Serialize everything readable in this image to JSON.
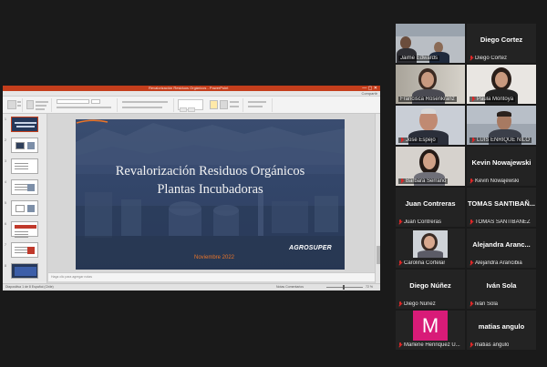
{
  "window": {
    "title": "Revalorización Residuos Orgánicos - PowerPoint",
    "menu": [
      "Archivo",
      "Inicio",
      "Insertar",
      "Diseño",
      "Transiciones",
      "Animaciones",
      "Presentación con diapositivas",
      "Revisar",
      "Vista",
      "Ayuda"
    ],
    "active_menu": "Inicio",
    "right_menu": "Compartir",
    "notes_placeholder": "Haga clic para agregar notas",
    "status_left": "Diapositiva 1 de 8  Español (Chile)",
    "status_mid": "Notas   Comentarios",
    "zoom": "72 %"
  },
  "slide": {
    "title_line1": "Revalorización Residuos Orgánicos",
    "title_line2": "Plantas Incubadoras",
    "date": "Noviembre 2022",
    "logo": "AGROSUPER"
  },
  "thumbnails": [
    "1",
    "2",
    "3",
    "4",
    "5",
    "6",
    "7",
    "8"
  ],
  "participants": [
    {
      "name": "Jaime Edwards",
      "big": "",
      "video": true
    },
    {
      "name": "Diego Cortez",
      "big": "Diego Cortez",
      "video": false
    },
    {
      "name": "Francisca Rosenkranz",
      "big": "",
      "video": true
    },
    {
      "name": "Paula Montoya",
      "big": "",
      "video": true
    },
    {
      "name": "José Espejo",
      "big": "",
      "video": true
    },
    {
      "name": "LUIS ENRIQUE NILO",
      "big": "",
      "video": true
    },
    {
      "name": "Barbara Serrano",
      "big": "",
      "video": true
    },
    {
      "name": "Kevin Nowajewski",
      "big": "Kevin Nowajewski",
      "video": false
    },
    {
      "name": "Juan Contreras",
      "big": "Juan Contreras",
      "video": false
    },
    {
      "name": "TOMAS SANTIBAÑEZ",
      "big": "TOMAS SANTIBAÑ...",
      "video": false
    },
    {
      "name": "Carolina Cortelar",
      "big": "",
      "video": true
    },
    {
      "name": "Alejandra Arancibia",
      "big": "Alejandra Aranc...",
      "video": false
    },
    {
      "name": "Diego Núñez",
      "big": "Diego Núñez",
      "video": false
    },
    {
      "name": "Iván Sola",
      "big": "Iván Sola",
      "video": false
    },
    {
      "name": "Marlene Henriquez U...",
      "big": "",
      "video": false,
      "avatar_letter": "M"
    },
    {
      "name": "matias angulo",
      "big": "matias angulo",
      "video": false
    }
  ]
}
